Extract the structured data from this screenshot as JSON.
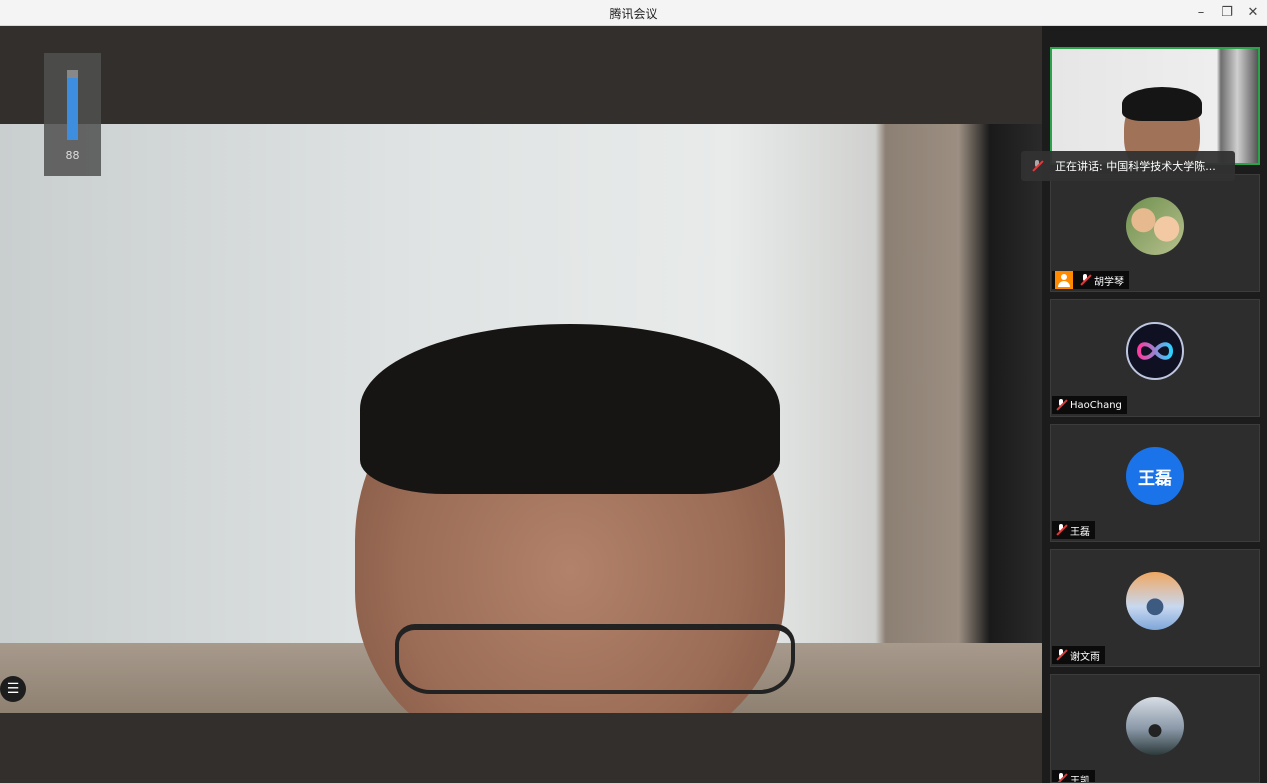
{
  "window": {
    "title": "腾讯会议",
    "minimize_glyph": "–",
    "restore_glyph": "❐",
    "close_glyph": "✕"
  },
  "main_stage": {
    "volume_level_percent": 88,
    "volume_label": "88",
    "menu_glyph": "☰"
  },
  "speaking_tooltip": {
    "icon": "mic-icon",
    "text": "正在讲话: 中国科学技术大学陈..."
  },
  "participants": [
    {
      "name": "",
      "avatar": "self-video",
      "active": true
    },
    {
      "name": "胡学琴",
      "avatar": "photo-family",
      "host": true
    },
    {
      "name": "HaoChang",
      "avatar": "infinity-logo"
    },
    {
      "name": "王磊",
      "avatar": "text",
      "avatar_text": "王磊",
      "avatar_color": "#1a73e8"
    },
    {
      "name": "谢文雨",
      "avatar": "photo-sky"
    },
    {
      "name": "王凯",
      "avatar": "photo-sea"
    }
  ],
  "colors": {
    "accent_blue": "#1a73e8",
    "active_border": "#2aa34a",
    "host_orange": "#ff8a00",
    "volume_blue": "#3e8ee0"
  }
}
